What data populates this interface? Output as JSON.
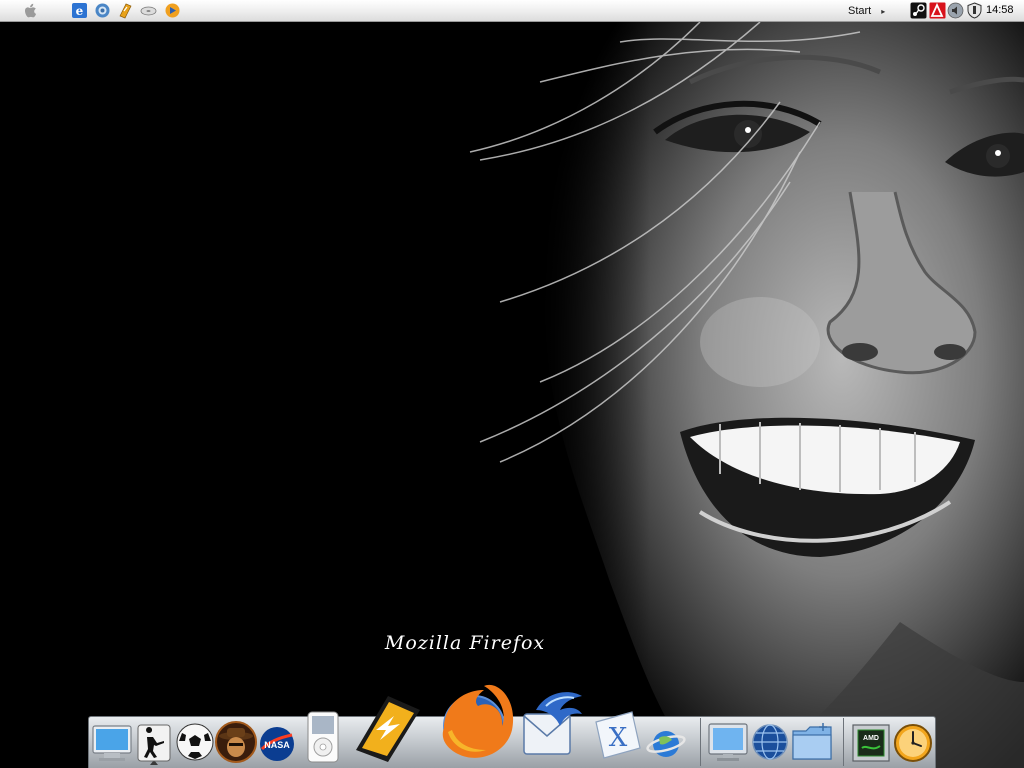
{
  "menubar": {
    "apple_menu_icon": "apple-logo-icon",
    "quick_launch": [
      {
        "name": "internet-explorer-icon"
      },
      {
        "name": "messenger-icon"
      },
      {
        "name": "winamp-icon"
      },
      {
        "name": "cd-drive-icon"
      },
      {
        "name": "media-player-icon"
      }
    ],
    "start_label": "Start",
    "start_arrow": "▸",
    "tray": [
      {
        "name": "steam-tray-icon"
      },
      {
        "name": "antivirus-tray-icon"
      },
      {
        "name": "speaker-tray-icon"
      },
      {
        "name": "shield-tray-icon"
      }
    ],
    "clock": "14:58"
  },
  "dock": {
    "running_app_label": "Mozilla Firefox",
    "items": [
      {
        "name": "my-computer-dock-icon"
      },
      {
        "name": "counter-strike-dock-icon"
      },
      {
        "name": "soccer-ball-dock-icon"
      },
      {
        "name": "cowboy-game-dock-icon"
      },
      {
        "name": "nasa-dock-icon"
      },
      {
        "name": "ipod-dock-icon"
      },
      {
        "name": "winamp-dock-icon"
      },
      {
        "name": "firefox-dock-icon"
      },
      {
        "name": "thunderbird-mail-dock-icon"
      },
      {
        "name": "mac-os-x-dock-icon"
      },
      {
        "name": "internet-globe-dock-icon"
      },
      {
        "name": "display-dock-icon"
      },
      {
        "name": "network-globe-dock-icon"
      },
      {
        "name": "documents-folder-dock-icon"
      },
      {
        "name": "amd-athlon-dock-icon"
      },
      {
        "name": "clock-dock-icon"
      }
    ]
  },
  "colors": {
    "menubar_bg": "#ececec",
    "desktop_bg": "#000000",
    "dock_shelf": "#c2c7cc",
    "firefox_orange": "#f07a1a",
    "firefox_blue": "#2a62b8",
    "clock_face": "#f2a51c"
  }
}
